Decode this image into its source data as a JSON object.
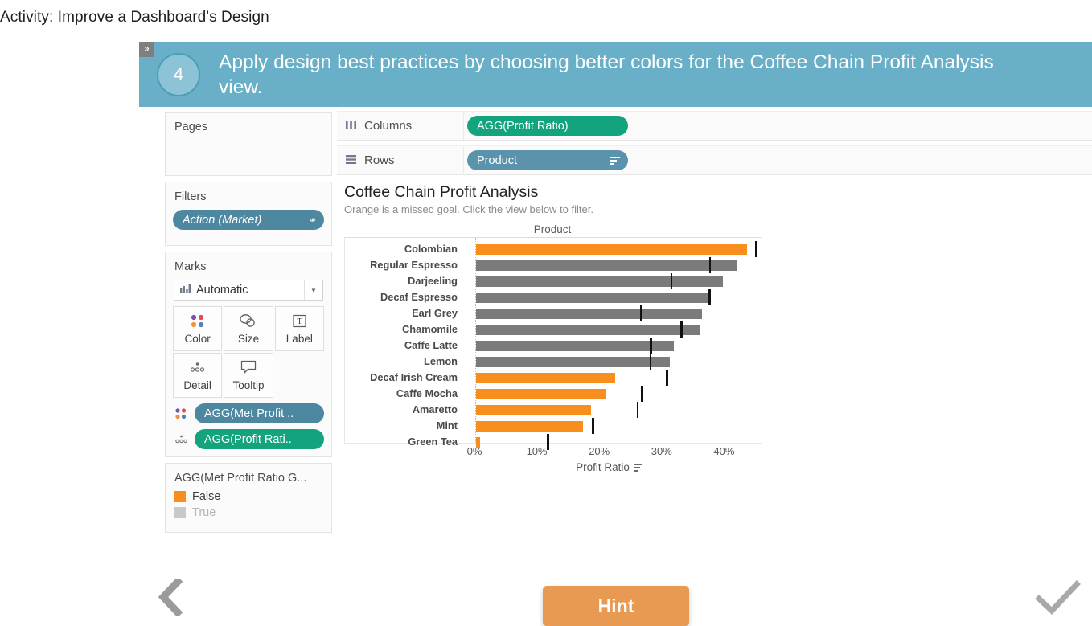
{
  "page": {
    "title": "Activity: Improve a Dashboard's Design"
  },
  "banner": {
    "collapse_glyph": "»",
    "step_number": "4",
    "instruction": "Apply design best practices by choosing better colors for the Coffee Chain Profit Analysis view.",
    "background_color": "#68afc7"
  },
  "cards": {
    "pages": {
      "title": "Pages"
    },
    "filters": {
      "title": "Filters",
      "pill_label": "Action (Market)",
      "pill_icon": "filter-link-icon"
    },
    "marks": {
      "title": "Marks",
      "mark_type": "Automatic",
      "mark_type_icon": "bar-chart-icon",
      "dropdown_icon": "chevron-down-icon",
      "buttons": [
        {
          "label": "Color",
          "icon": "color-dots-icon"
        },
        {
          "label": "Size",
          "icon": "size-shapes-icon"
        },
        {
          "label": "Label",
          "icon": "text-label-icon"
        },
        {
          "label": "Detail",
          "icon": "detail-dots-icon"
        },
        {
          "label": "Tooltip",
          "icon": "tooltip-bubble-icon"
        }
      ],
      "pills": [
        {
          "label": "AGG(Met Profit ..",
          "color": "#4e87a0",
          "icon": "color-dots-icon"
        },
        {
          "label": "AGG(Profit Rati..",
          "color": "#14a47d",
          "icon": "detail-dots-icon"
        }
      ]
    },
    "legend": {
      "title": "AGG(Met Profit Ratio G...",
      "items": [
        {
          "label": "False",
          "color": "#f78e1e"
        },
        {
          "label": "True",
          "color": "#bfbfbf"
        }
      ]
    }
  },
  "shelves": [
    {
      "name": "Columns",
      "icon": "columns-icon",
      "pill_label": "AGG(Profit Ratio)",
      "pill_color": "#14a47d",
      "pill_sort": false
    },
    {
      "name": "Rows",
      "icon": "rows-icon",
      "pill_label": "Product",
      "pill_color": "#5a93ab",
      "pill_sort": true
    }
  ],
  "viz": {
    "title": "Coffee Chain Profit Analysis",
    "subtitle": "Orange is a missed goal. Click the view below to filter."
  },
  "chart_data": {
    "type": "bar",
    "title": "Coffee Chain Profit Analysis",
    "subtitle": "Orange is a missed goal. Click the view below to filter.",
    "orientation": "horizontal",
    "row_field_header": "Product",
    "xlabel": "Profit Ratio",
    "ylabel": "Product",
    "xlim": [
      0,
      46
    ],
    "xticks": [
      0,
      10,
      20,
      30,
      40
    ],
    "xticklabels": [
      "0%",
      "10%",
      "20%",
      "30%",
      "40%"
    ],
    "grid": false,
    "legend": {
      "title": "AGG(Met Profit Ratio G...",
      "position": "left-panel",
      "entries": [
        {
          "label": "False",
          "color": "#f78e1e"
        },
        {
          "label": "True",
          "color": "#bfbfbf"
        }
      ]
    },
    "colors": {
      "missed_goal": "#f78e1e",
      "met_goal": "#7b7b7b",
      "reference_line": "#111111"
    },
    "categories": [
      "Colombian",
      "Regular Espresso",
      "Darjeeling",
      "Decaf Espresso",
      "Earl Grey",
      "Chamomile",
      "Caffe Latte",
      "Lemon",
      "Decaf Irish Cream",
      "Caffe Mocha",
      "Amaretto",
      "Mint",
      "Green Tea"
    ],
    "series": [
      {
        "name": "Profit Ratio",
        "unit": "percent",
        "values": [
          43.4,
          41.8,
          39.5,
          37.6,
          36.2,
          36.0,
          31.7,
          31.1,
          22.3,
          20.7,
          18.4,
          17.1,
          0.6
        ]
      },
      {
        "name": "Met Profit Ratio Goal",
        "values": [
          false,
          true,
          true,
          true,
          true,
          true,
          true,
          true,
          false,
          false,
          false,
          false,
          false
        ]
      },
      {
        "name": "Profit Ratio Goal (reference line)",
        "unit": "percent",
        "values": [
          44.9,
          37.5,
          31.3,
          37.4,
          26.4,
          32.9,
          28.0,
          27.9,
          30.6,
          26.6,
          25.9,
          18.7,
          11.5
        ]
      }
    ]
  },
  "controls": {
    "hint_label": "Hint",
    "back_icon": "chevron-left-icon",
    "check_icon": "checkmark-icon",
    "hint_color": "#e89a52"
  }
}
